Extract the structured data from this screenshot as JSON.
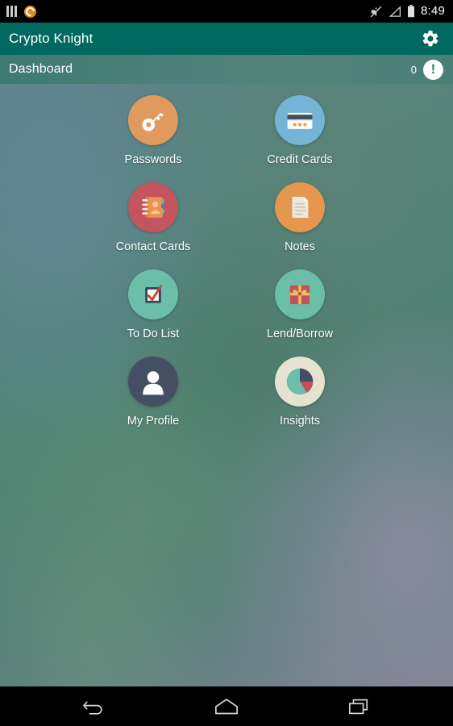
{
  "status_bar": {
    "icons_left": [
      "bars-icon",
      "app-notification-icon"
    ],
    "icons_right": [
      "mute-icon",
      "signal-icon",
      "battery-icon"
    ],
    "time": "8:49"
  },
  "app_bar": {
    "title": "Crypto Knight",
    "settings_icon": "gear-icon"
  },
  "sub_bar": {
    "title": "Dashboard",
    "alert_count": "0",
    "alert_icon": "exclamation-icon",
    "alert_symbol": "!"
  },
  "dashboard": {
    "rows": [
      [
        {
          "label": "Passwords",
          "icon": "key-icon",
          "circle_color": "#e09a5e"
        },
        {
          "label": "Credit Cards",
          "icon": "credit-card-icon",
          "circle_color": "#75b4d6"
        }
      ],
      [
        {
          "label": "Contact Cards",
          "icon": "address-book-icon",
          "circle_color": "#c4555f"
        },
        {
          "label": "Notes",
          "icon": "document-icon",
          "circle_color": "#e4974f"
        }
      ],
      [
        {
          "label": "To Do List",
          "icon": "checkbox-icon",
          "circle_color": "#6bbfa9"
        },
        {
          "label": "Lend/Borrow",
          "icon": "gift-icon",
          "circle_color": "#6bbfa9"
        }
      ],
      [
        {
          "label": "My Profile",
          "icon": "person-icon",
          "circle_color": "#454f63"
        },
        {
          "label": "Insights",
          "icon": "pie-chart-icon",
          "circle_color": "#e6e2d2"
        }
      ]
    ]
  },
  "nav_bar": {
    "buttons": [
      {
        "name": "back-button",
        "icon": "back-arrow-icon"
      },
      {
        "name": "home-button",
        "icon": "home-icon"
      },
      {
        "name": "recents-button",
        "icon": "recents-icon"
      }
    ]
  },
  "colors": {
    "app_bar": "#00695f",
    "status_bar": "#000000",
    "nav_bar": "#000000",
    "accent_text": "#ffffff"
  }
}
